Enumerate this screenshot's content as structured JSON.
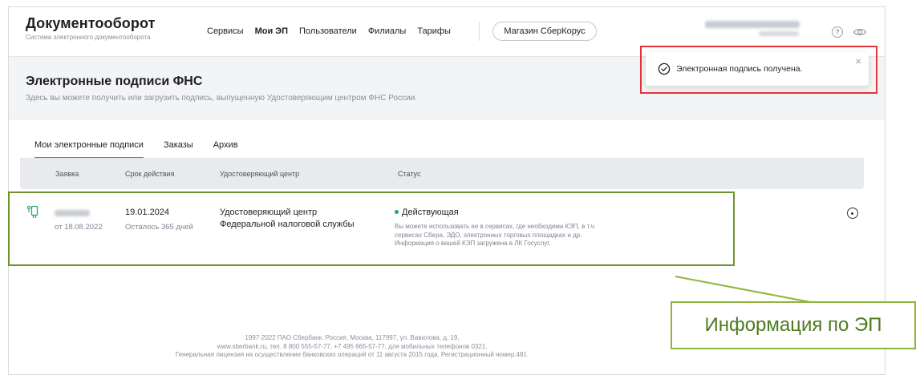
{
  "brand": {
    "title": "Документооборот",
    "subtitle": "Система электронного документооборота"
  },
  "nav": {
    "items": [
      "Сервисы",
      "Мои ЭП",
      "Пользователи",
      "Филиалы",
      "Тарифы"
    ],
    "active": "Мои ЭП",
    "store_button": "Магазин СберКорус"
  },
  "header_icons": {
    "help": "help-icon",
    "visibility": "eye-icon"
  },
  "page": {
    "title": "Электронные подписи ФНС",
    "description": "Здесь вы можете получить или загрузить подпись, выпущенную Удостоверяющим центром ФНС России."
  },
  "toast": {
    "message": "Электронная подпись получена.",
    "close": "×"
  },
  "tabs": [
    {
      "label": "Мои электронные подписи",
      "active": true
    },
    {
      "label": "Заказы",
      "active": false
    },
    {
      "label": "Архив",
      "active": false
    }
  ],
  "table": {
    "headers": {
      "request": "Заявка",
      "validity": "Срок действия",
      "ca": "Удостоверяющий центр",
      "status": "Статус"
    },
    "rows": [
      {
        "request_date": "от 18.08.2022",
        "valid_until": "19.01.2024",
        "days_left": "Осталось 365 дней",
        "ca_line1": "Удостоверяющий центр",
        "ca_line2": "Федеральной налоговой службы",
        "status": "Действующая",
        "status_color": "#2aa37a",
        "status_desc_1": "Вы можете использовать ее в сервисах, где необходима КЭП, в т.ч.",
        "status_desc_2": "сервисах Сбера, ЭДО, электронных торговых площадках и др.",
        "status_desc_3": "Информация о вашей КЭП загружена в ЛК Госуслуг."
      }
    ]
  },
  "footer": {
    "line1": "1997-2022 ПАО Сбербанк. Россия, Москва, 117997, ул. Вавилова, д. 19,",
    "line2": "www.sberbank.ru, тел. 8 800 555-57-77, +7 495 665-57-77, для мобильных телефонов 0321.",
    "line3": "Генеральная лицензия на осуществление банковских операций от 11 августа 2015 года. Регистрационный номер.481."
  },
  "callout": {
    "label": "Информация по ЭП"
  },
  "colors": {
    "accent": "#2aa37a",
    "highlight_red": "#e2343a",
    "highlight_green": "#6f932a"
  }
}
